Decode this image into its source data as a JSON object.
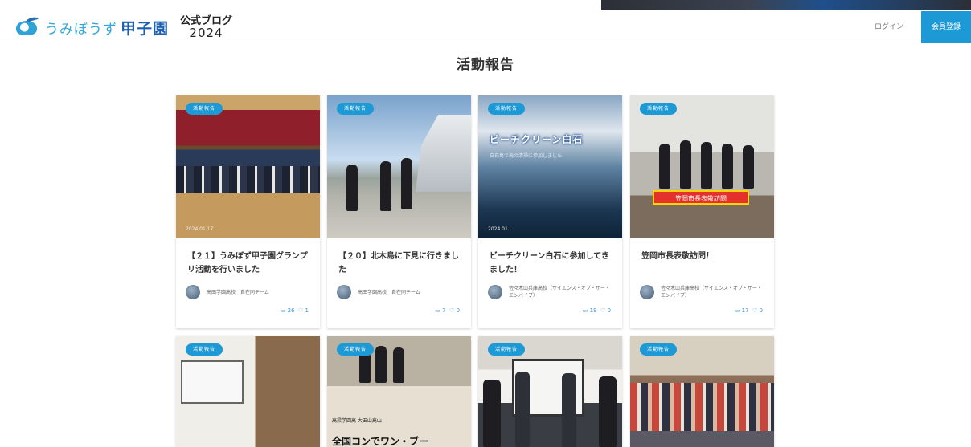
{
  "header": {
    "logo_umibozu": "うみぼうず",
    "logo_koshien": "甲子園",
    "blog_label": "公式ブログ",
    "year": "2024",
    "login": "ログイン",
    "register": "会員登録"
  },
  "page_title": "活動報告",
  "colors": {
    "accent": "#1d9ad6",
    "stats": "#3d8fd0"
  },
  "cards": [
    {
      "category": "活動報告",
      "date": "2024.01.17",
      "title": "【２１】うみぼず甲子園グランプリ活動を行いました",
      "author": "高田学園高校　自在同チーム",
      "views": "26",
      "likes": "1"
    },
    {
      "category": "活動報告",
      "date": "",
      "title": "【２０】北木島に下見に行きました",
      "author": "高田学園高校　自在同チーム",
      "views": "7",
      "likes": "0"
    },
    {
      "category": "活動報告",
      "date": "2024.01.",
      "title": "ビーチクリーン白石に参加してきました！",
      "author": "佐々木山兵庫高校（サイエンス・オブ・ザー・エンバイブ）",
      "views": "19",
      "likes": "0",
      "image_text": "ビーチクリーン白石",
      "image_subtext": "白石島で海の清掃に参加しました"
    },
    {
      "category": "活動報告",
      "date": "",
      "title": "笠岡市長表敬訪問！",
      "author": "佐々木山兵庫高校（サイエンス・オブ・ザー・エンバイブ）",
      "views": "17",
      "likes": "0",
      "image_text": "笠岡市長表敬訪問"
    },
    {
      "category": "活動報告"
    },
    {
      "category": "活動報告",
      "image_head": "高梁学園高 大田山高山",
      "image_text": "全国コンでワン・ブー"
    },
    {
      "category": "活動報告"
    },
    {
      "category": "活動報告"
    }
  ]
}
